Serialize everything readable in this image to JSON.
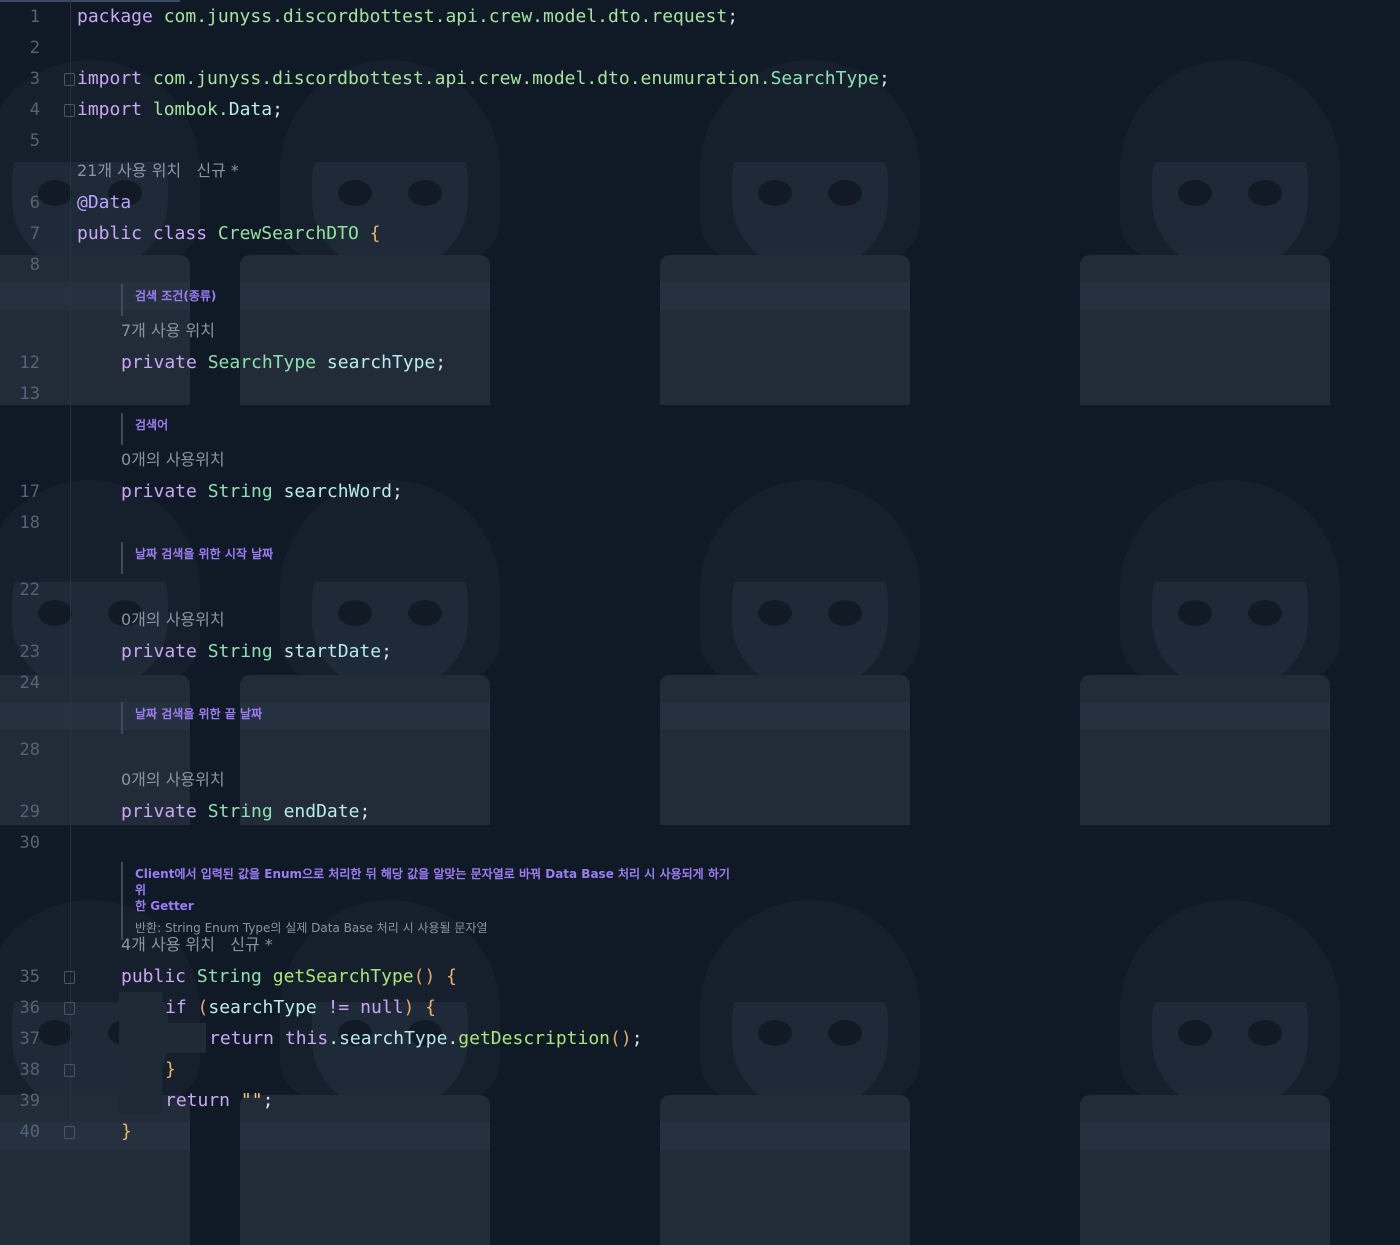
{
  "lines": {
    "l1": "1",
    "l2": "2",
    "l3": "3",
    "l4": "4",
    "l5": "5",
    "l6": "6",
    "l7": "7",
    "l8": "8",
    "l12": "12",
    "l13": "13",
    "l17": "17",
    "l18": "18",
    "l22": "22",
    "l23": "23",
    "l24": "24",
    "l28": "28",
    "l29": "29",
    "l30": "30",
    "l35": "35",
    "l36": "36",
    "l37": "37",
    "l38": "38",
    "l39": "39",
    "l40": "40"
  },
  "code": {
    "package_kw": "package",
    "package_name": "com.junyss.discordbottest.api.crew.model.dto.request",
    "import_kw": "import",
    "import1_path": "com.junyss.discordbottest.api.crew.model.dto.enumuration.",
    "import1_class": "SearchType",
    "import2_path": "lombok.",
    "import2_class": "Data",
    "semicolon": ";",
    "annotation": "@Data",
    "public_kw": "public",
    "class_kw": "class",
    "class_name": "CrewSearchDTO",
    "open_brace": "{",
    "close_brace": "}",
    "private_kw": "private",
    "type_searchtype": "SearchType",
    "field_searchtype": "searchType",
    "type_string": "String",
    "field_searchword": "searchWord",
    "field_startdate": "startDate",
    "field_enddate": "endDate",
    "method_name": "getSearchType",
    "parens": "()",
    "if_kw": "if",
    "open_paren": "(",
    "close_paren": ")",
    "neq": "!=",
    "null_kw": "null",
    "return_kw": "return",
    "this_kw": "this",
    "dot": ".",
    "get_desc": "getDescription",
    "empty_str": "\"\""
  },
  "hints": {
    "class_usages": "21개 사용 위치",
    "class_new": "신규 *",
    "searchtype_usages": "7개 사용 위치",
    "searchword_usages": "0개의 사용위치",
    "startdate_usages": "0개의 사용위치",
    "enddate_usages": "0개의 사용위치",
    "getter_usages": "4개 사용 위치",
    "getter_new": "신규 *"
  },
  "docs": {
    "searchtype": "검색 조건(종류)",
    "searchword": "검색어",
    "startdate": "날짜 검색을 위한 시작 날짜",
    "enddate": "날짜 검색을 위한 끝 날짜",
    "getter_line1": "Client에서 입력된 값을 Enum으로 처리한 뒤 해당 값을 알맞는 문자열로 바꿔 Data Base 처리 시 사용되게 하기 위",
    "getter_line2": "한 Getter",
    "getter_return": "반환: String Enum Type의 실제 Data Base 처리 시 사용될 문자열"
  }
}
